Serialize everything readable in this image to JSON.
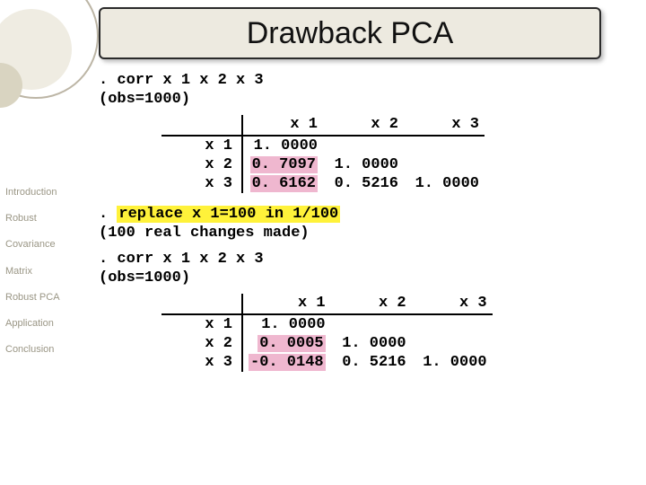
{
  "title": "Drawback PCA",
  "sidebar": {
    "items": [
      {
        "label": "Introduction"
      },
      {
        "label": "Robust"
      },
      {
        "label": "Covariance"
      },
      {
        "label": "Matrix"
      },
      {
        "label": "Robust PCA"
      },
      {
        "label": "Application"
      },
      {
        "label": "Conclusion"
      }
    ]
  },
  "block1": {
    "cmd": ". corr x 1 x 2 x 3",
    "obs": "(obs=1000)",
    "cols": [
      "x 1",
      "x 2",
      "x 3"
    ],
    "rows": [
      "x 1",
      "x 2",
      "x 3"
    ],
    "vals": {
      "r0c0": "1. 0000",
      "r1c0": "0. 7097",
      "r1c1": "1. 0000",
      "r2c0": "0. 6162",
      "r2c1": "0. 5216",
      "r2c2": "1. 0000"
    }
  },
  "replace": {
    "prefix": ". ",
    "cmd": "replace x 1=100 in 1/100",
    "note": "(100 real changes made)"
  },
  "block2": {
    "cmd": ". corr x 1 x 2 x 3",
    "obs": "(obs=1000)",
    "cols": [
      "x 1",
      "x 2",
      "x 3"
    ],
    "rows": [
      "x 1",
      "x 2",
      "x 3"
    ],
    "vals": {
      "r0c0": "1. 0000",
      "r1c0": "0. 0005",
      "r1c1": "1. 0000",
      "r2c0": "-0. 0148",
      "r2c1": "0. 5216",
      "r2c2": "1. 0000"
    }
  }
}
